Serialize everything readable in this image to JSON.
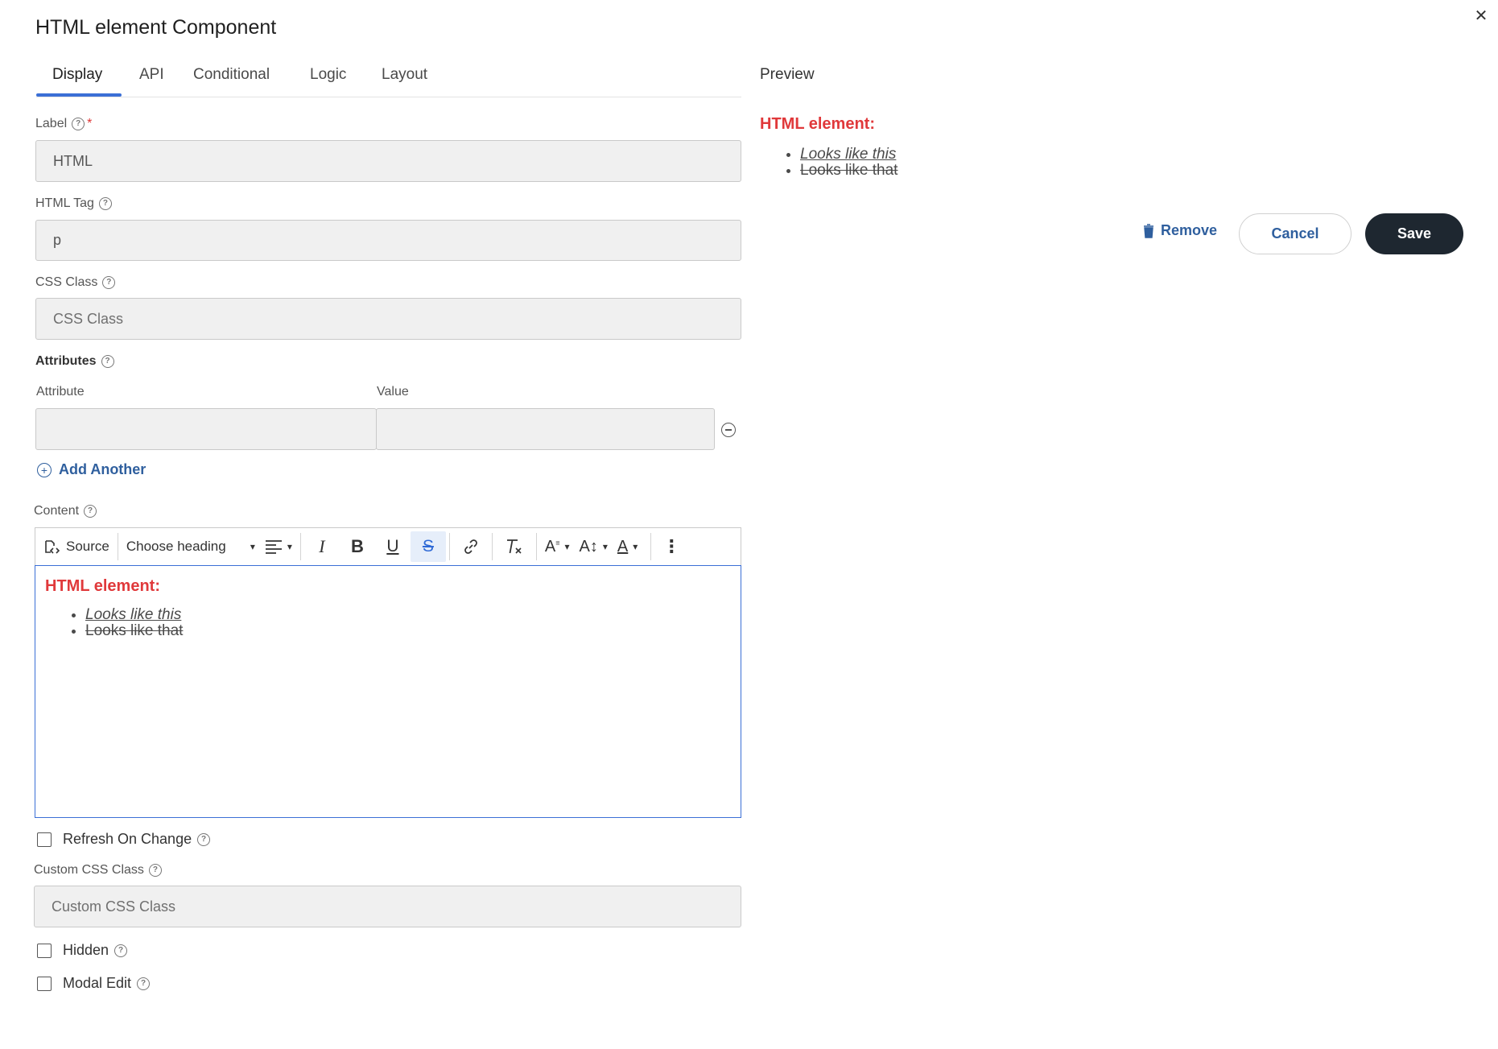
{
  "dialog": {
    "title": "HTML element Component"
  },
  "tabs": [
    {
      "label": "Display",
      "active": true
    },
    {
      "label": "API"
    },
    {
      "label": "Conditional"
    },
    {
      "label": "Logic"
    },
    {
      "label": "Layout"
    }
  ],
  "form": {
    "label": {
      "label": "Label",
      "required_mark": "*",
      "value": "HTML"
    },
    "html_tag": {
      "label": "HTML Tag",
      "value": "p"
    },
    "css_class": {
      "label": "CSS Class",
      "placeholder": "CSS Class"
    },
    "attributes": {
      "label": "Attributes",
      "col_attribute": "Attribute",
      "col_value": "Value",
      "add_another": "Add Another"
    },
    "content": {
      "label": "Content",
      "toolbar": {
        "source": "Source",
        "heading": "Choose heading"
      },
      "heading": "HTML element:",
      "items": [
        "Looks like this",
        "Looks like that"
      ]
    },
    "refresh_on_change": {
      "label": "Refresh On Change",
      "checked": false
    },
    "custom_css_class": {
      "label": "Custom CSS Class",
      "placeholder": "Custom CSS Class"
    },
    "hidden": {
      "label": "Hidden",
      "checked": false
    },
    "modal_edit": {
      "label": "Modal Edit",
      "checked": false
    }
  },
  "preview": {
    "label": "Preview",
    "heading": "HTML element:",
    "items": [
      "Looks like this",
      "Looks like that"
    ]
  },
  "actions": {
    "remove": "Remove",
    "cancel": "Cancel",
    "save": "Save"
  },
  "colors": {
    "accent": "#3b6fd6",
    "link": "#2f5f9e",
    "heading_red": "#e0393b",
    "save_bg": "#1e2730"
  }
}
